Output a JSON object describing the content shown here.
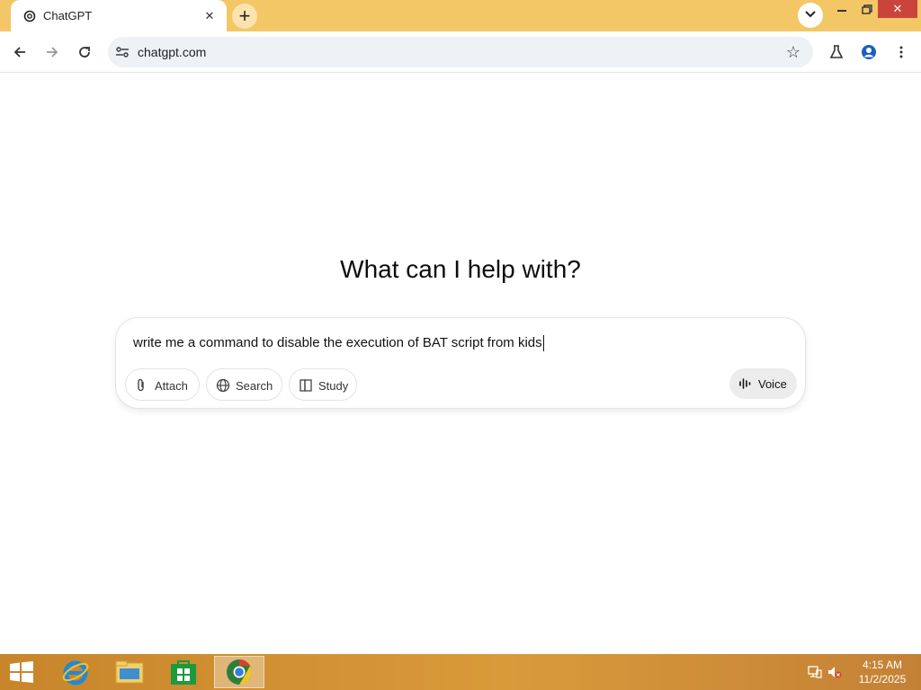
{
  "browser": {
    "tab_title": "ChatGPT",
    "tab_close": "✕",
    "new_tab": "+",
    "url": "chatgpt.com",
    "win_close": "✕"
  },
  "main": {
    "headline": "What can I help with?",
    "prompt_text": "write me a command to disable the execution of BAT script from kids",
    "buttons": {
      "attach": "Attach",
      "search": "Search",
      "study": "Study",
      "voice": "Voice"
    }
  },
  "taskbar": {
    "time": "4:15 AM",
    "date": "11/2/2025"
  },
  "icons": {
    "tab": "chatgpt-logo-icon",
    "nav": [
      "back-arrow-icon",
      "forward-arrow-icon",
      "reload-icon"
    ],
    "omnibox": [
      "site-settings-icon",
      "bookmark-star-icon"
    ],
    "toolbar_right": [
      "labs-flask-icon",
      "profile-icon",
      "menu-dots-icon"
    ],
    "composer": [
      "paperclip-icon",
      "globe-icon",
      "book-icon",
      "voice-wave-icon"
    ],
    "taskbar": [
      "windows-start-icon",
      "internet-explorer-icon",
      "file-explorer-icon",
      "store-icon",
      "chrome-icon"
    ],
    "tray": [
      "network-icon",
      "volume-muted-icon"
    ]
  },
  "colors": {
    "titlebar": "#f3c766",
    "taskbar": "#d99a3a",
    "close_button": "#c9443a",
    "omnibox": "#eef1f6"
  }
}
